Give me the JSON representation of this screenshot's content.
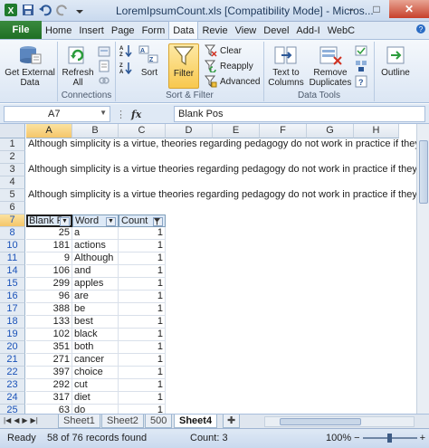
{
  "window": {
    "title": "LoremIpsumCount.xls  [Compatibility Mode] - Micros...",
    "minimize": "–",
    "maximize": "□",
    "close": "✕"
  },
  "ribbon": {
    "file_tab": "File",
    "tabs": [
      "Home",
      "Insert",
      "Page",
      "Form",
      "Data",
      "Revie",
      "View",
      "Devel",
      "Add-I",
      "WebC"
    ],
    "active_tab": "Data",
    "get_external_data": "Get External Data",
    "refresh_all": "Refresh All",
    "connections_group": "Connections",
    "sort": "Sort",
    "filter": "Filter",
    "clear": "Clear",
    "reapply": "Reapply",
    "advanced": "Advanced",
    "sort_filter_group": "Sort & Filter",
    "text_to_columns": "Text to Columns",
    "remove_duplicates": "Remove Duplicates",
    "data_tools_group": "Data Tools",
    "outline": "Outline"
  },
  "formula_bar": {
    "name_box": "A7",
    "fx": "fx",
    "formula": "Blank Pos"
  },
  "grid": {
    "columns": [
      "A",
      "B",
      "C",
      "D",
      "E",
      "F",
      "G",
      "H"
    ],
    "selected_column": "A",
    "selected_row": "7",
    "text_rows": [
      {
        "row": "1",
        "text": "Although simplicity is a virtue, theories regarding pedagogy do not work in practice if they"
      },
      {
        "row": "2",
        "text": ""
      },
      {
        "row": "3",
        "text": "Although simplicity is a virtue theories regarding pedagogy do not work in practice if they"
      },
      {
        "row": "4",
        "text": ""
      },
      {
        "row": "5",
        "text": "Although simplicity is a virtue theories regarding pedagogy do not work in practice if they"
      },
      {
        "row": "6",
        "text": ""
      }
    ],
    "header_row": {
      "row": "7",
      "col_a": "Blank P",
      "col_b": "Word",
      "col_c": "Count"
    },
    "data_rows": [
      {
        "row": "8",
        "a": "25",
        "b": "a",
        "c": "1"
      },
      {
        "row": "10",
        "a": "181",
        "b": "actions",
        "c": "1"
      },
      {
        "row": "11",
        "a": "9",
        "b": "Although",
        "c": "1"
      },
      {
        "row": "14",
        "a": "106",
        "b": "and",
        "c": "1"
      },
      {
        "row": "15",
        "a": "299",
        "b": "apples",
        "c": "1"
      },
      {
        "row": "16",
        "a": "96",
        "b": "are",
        "c": "1"
      },
      {
        "row": "17",
        "a": "388",
        "b": "be",
        "c": "1"
      },
      {
        "row": "18",
        "a": "133",
        "b": "best",
        "c": "1"
      },
      {
        "row": "19",
        "a": "102",
        "b": "black",
        "c": "1"
      },
      {
        "row": "20",
        "a": "351",
        "b": "both",
        "c": "1"
      },
      {
        "row": "21",
        "a": "271",
        "b": "cancer",
        "c": "1"
      },
      {
        "row": "22",
        "a": "397",
        "b": "choice",
        "c": "1"
      },
      {
        "row": "23",
        "a": "292",
        "b": "cut",
        "c": "1"
      },
      {
        "row": "24",
        "a": "317",
        "b": "diet",
        "c": "1"
      },
      {
        "row": "25",
        "a": "63",
        "b": "do",
        "c": "1"
      }
    ]
  },
  "sheets": {
    "tabs": [
      "Sheet1",
      "Sheet2",
      "500",
      "Sheet4"
    ],
    "active": "Sheet4"
  },
  "status": {
    "ready": "Ready",
    "records": "58 of 76 records found",
    "count": "Count: 3",
    "zoom": "100%"
  }
}
